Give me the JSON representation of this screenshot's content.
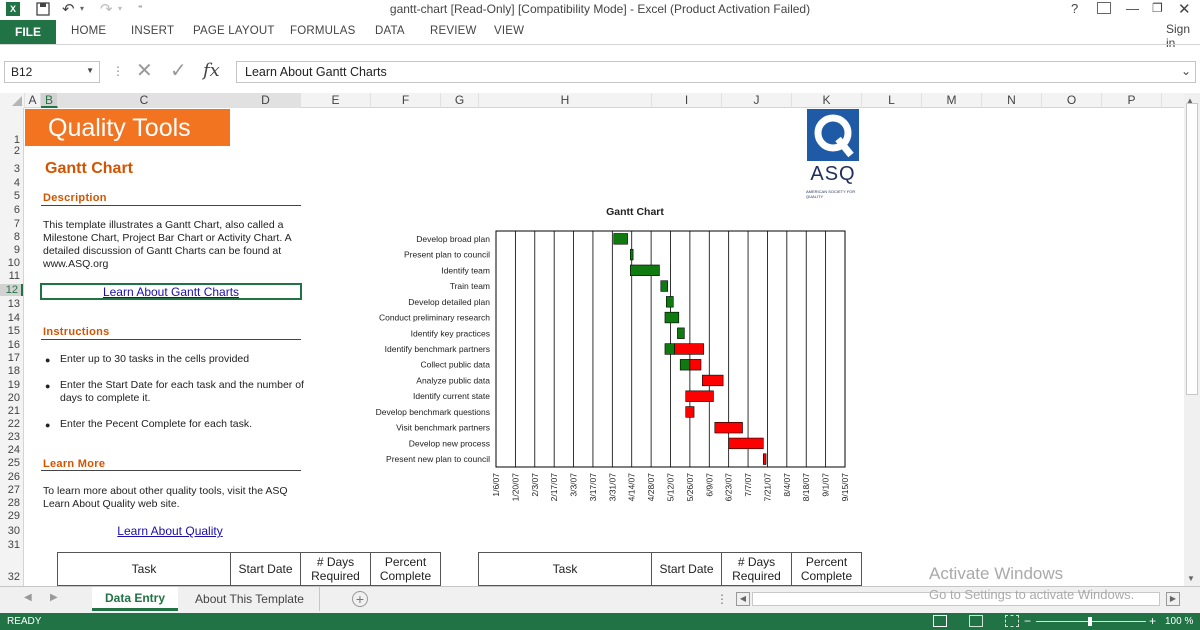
{
  "window": {
    "title": "gantt-chart  [Read-Only]  [Compatibility Mode] - Excel (Product Activation Failed)",
    "help": "?",
    "sign_in": "Sign in"
  },
  "ribbon": {
    "file": "FILE",
    "tabs": [
      "HOME",
      "INSERT",
      "PAGE LAYOUT",
      "FORMULAS",
      "DATA",
      "REVIEW",
      "VIEW"
    ]
  },
  "formula_bar": {
    "name_box": "B12",
    "formula": "Learn About Gantt Charts",
    "fx": "fx"
  },
  "columns": [
    "A",
    "B",
    "C",
    "D",
    "E",
    "F",
    "G",
    "H",
    "I",
    "J",
    "K",
    "L",
    "M",
    "N",
    "O",
    "P"
  ],
  "rows": [
    "1",
    "2",
    "3",
    "4",
    "5",
    "6",
    "7",
    "8",
    "9",
    "10",
    "11",
    "12",
    "13",
    "14",
    "15",
    "16",
    "17",
    "18",
    "19",
    "20",
    "21",
    "22",
    "23",
    "24",
    "25",
    "26",
    "27",
    "28",
    "29",
    "30",
    "31",
    "32"
  ],
  "sheet": {
    "banner": "Quality Tools",
    "heading": "Gantt Chart",
    "description_title": "Description",
    "description_text": "This template illustrates a Gantt Chart, also called a Milestone Chart, Project Bar Chart or Activity Chart.  A detailed discussion of Gantt Charts can be found at www.ASQ.org",
    "link_gantt": "Learn About Gantt Charts",
    "instructions_title": "Instructions",
    "instructions": [
      "Enter up to 30 tasks in the cells provided",
      "Enter the Start Date for each task and the number of days to complete it.",
      "Enter the Pecent Complete for each task."
    ],
    "learn_more_title": "Learn More",
    "learn_more_text": "To learn more about other quality tools, visit the ASQ Learn About Quality web site.",
    "link_quality": "Learn About Quality",
    "logo_text": "ASQ",
    "logo_subtext": "AMERICAN SOCIETY FOR QUALITY",
    "table_headers": [
      "Task",
      "Start Date",
      "# Days Required",
      "Percent Complete"
    ],
    "table2_headers": [
      "Task",
      "Start Date",
      "# Days Required",
      "Percent Complete"
    ]
  },
  "chart_data": {
    "type": "bar",
    "title": "Gantt Chart",
    "x_ticks": [
      "1/6/07",
      "1/20/07",
      "2/3/07",
      "2/17/07",
      "3/3/07",
      "3/17/07",
      "3/31/07",
      "4/14/07",
      "4/28/07",
      "5/12/07",
      "5/26/07",
      "6/9/07",
      "6/23/07",
      "7/7/07",
      "7/21/07",
      "8/4/07",
      "8/18/07",
      "9/1/07",
      "9/15/07"
    ],
    "x_range": [
      "2007-01-06",
      "2007-09-15"
    ],
    "tasks": [
      {
        "name": "Develop broad plan",
        "start": "2007-04-01",
        "complete_days": 10,
        "remaining_days": 0
      },
      {
        "name": "Present plan to council",
        "start": "2007-04-13",
        "complete_days": 2,
        "remaining_days": 0
      },
      {
        "name": "Identify team",
        "start": "2007-04-13",
        "complete_days": 21,
        "remaining_days": 0
      },
      {
        "name": "Train team",
        "start": "2007-05-05",
        "complete_days": 5,
        "remaining_days": 0
      },
      {
        "name": "Develop detailed plan",
        "start": "2007-05-09",
        "complete_days": 5,
        "remaining_days": 0
      },
      {
        "name": "Conduct preliminary research",
        "start": "2007-05-08",
        "complete_days": 10,
        "remaining_days": 0
      },
      {
        "name": "Identify key practices",
        "start": "2007-05-17",
        "complete_days": 5,
        "remaining_days": 0
      },
      {
        "name": "Identify benchmark partners",
        "start": "2007-05-08",
        "complete_days": 7,
        "remaining_days": 21
      },
      {
        "name": "Collect public data",
        "start": "2007-05-19",
        "complete_days": 7,
        "remaining_days": 8
      },
      {
        "name": "Analyze public data",
        "start": "2007-06-04",
        "complete_days": 0,
        "remaining_days": 15
      },
      {
        "name": "Identify current state",
        "start": "2007-05-23",
        "complete_days": 0,
        "remaining_days": 20
      },
      {
        "name": "Develop benchmark questions",
        "start": "2007-05-23",
        "complete_days": 0,
        "remaining_days": 6
      },
      {
        "name": "Visit benchmark partners",
        "start": "2007-06-13",
        "complete_days": 0,
        "remaining_days": 20
      },
      {
        "name": "Develop new process",
        "start": "2007-06-23",
        "complete_days": 0,
        "remaining_days": 25
      },
      {
        "name": "Present new plan to council",
        "start": "2007-07-18",
        "complete_days": 0,
        "remaining_days": 2
      }
    ],
    "colors": {
      "complete": "#0f7a0f",
      "remaining": "#ff0000"
    },
    "grid": true
  },
  "sheet_tabs": [
    "Data Entry",
    "About This Template"
  ],
  "status": {
    "ready": "READY",
    "zoom": "100 %"
  },
  "watermark": {
    "line1": "Activate Windows",
    "line2": "Go to Settings to activate Windows."
  }
}
